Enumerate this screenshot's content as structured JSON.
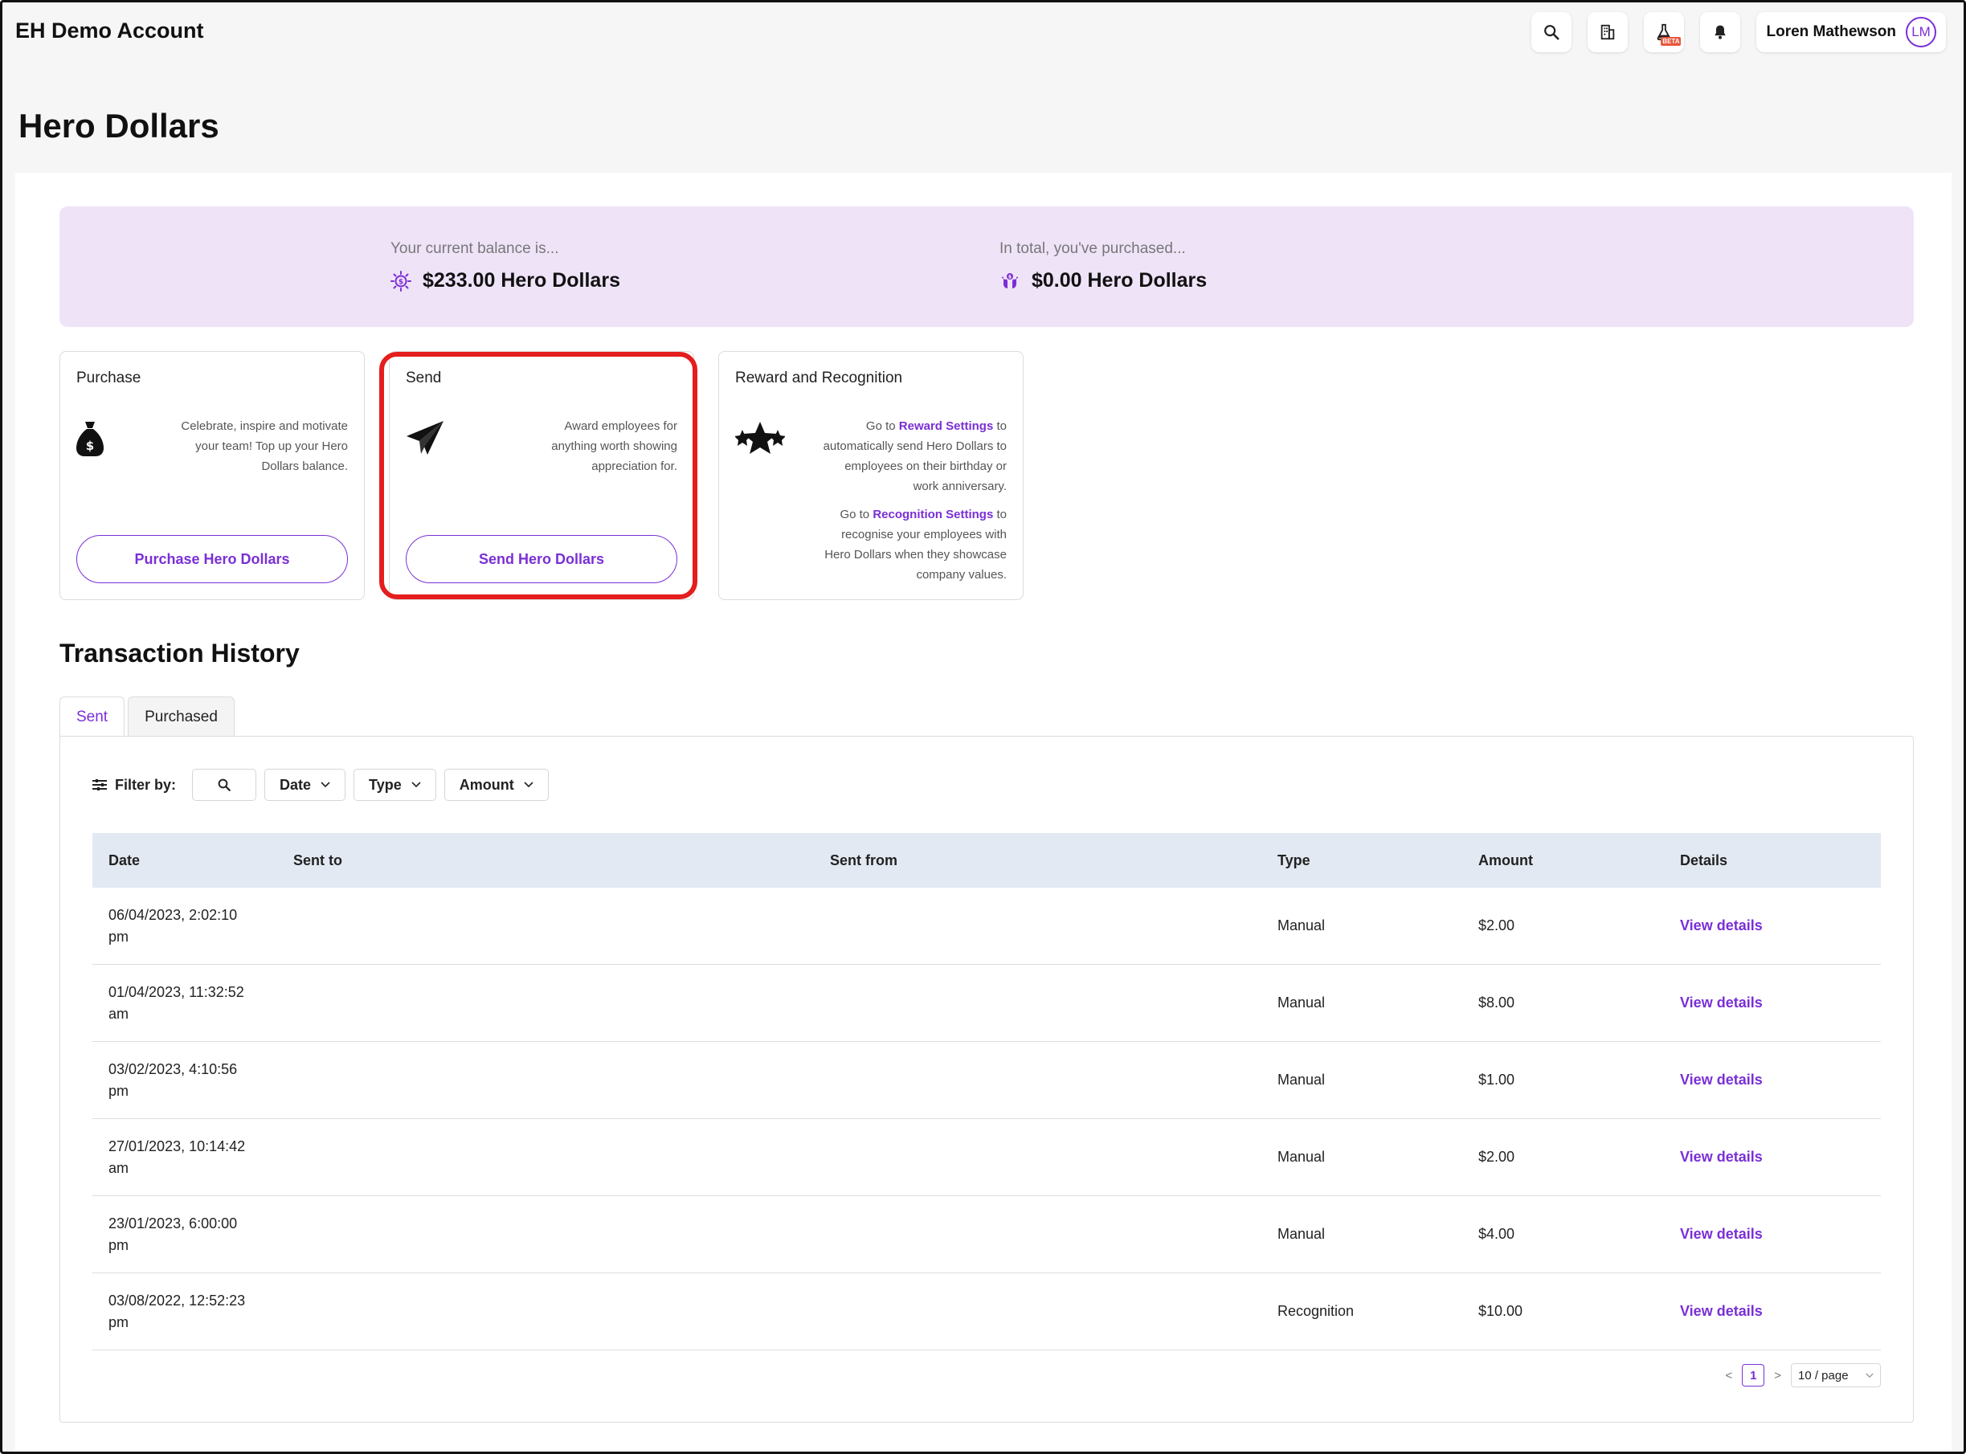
{
  "header": {
    "account_name": "EH Demo Account",
    "user_name": "Loren Mathewson",
    "user_initials": "LM",
    "beta_label": "BETA"
  },
  "page_title": "Hero Dollars",
  "balance": {
    "current_label": "Your current balance is...",
    "current_value": "$233.00 Hero Dollars",
    "purchased_label": "In total, you've purchased...",
    "purchased_value": "$0.00 Hero Dollars"
  },
  "cards": {
    "purchase": {
      "title": "Purchase",
      "description": "Celebrate, inspire and motivate your team! Top up your Hero Dollars balance.",
      "button": "Purchase Hero Dollars"
    },
    "send": {
      "title": "Send",
      "description": "Award employees for anything worth showing appreciation for.",
      "button": "Send Hero Dollars"
    },
    "reward": {
      "title": "Reward and Recognition",
      "p1_prefix": "Go to",
      "p1_link": "Reward Settings",
      "p1_suffix": "to automatically send Hero Dollars to employees on their birthday or work anniversary.",
      "p2_prefix": "Go to",
      "p2_link": "Recognition Settings",
      "p2_suffix": "to recognise your employees with Hero Dollars when they showcase company values."
    }
  },
  "history": {
    "title": "Transaction History",
    "tabs": [
      {
        "label": "Sent",
        "active": true
      },
      {
        "label": "Purchased",
        "active": false
      }
    ],
    "filter_label": "Filter by:",
    "filters": [
      "Date",
      "Type",
      "Amount"
    ],
    "columns": [
      "Date",
      "Sent to",
      "Sent from",
      "Type",
      "Amount",
      "Details"
    ],
    "rows": [
      {
        "date": "06/04/2023, 2:02:10",
        "date2": "pm",
        "sent_to": "",
        "sent_from": "",
        "type": "Manual",
        "amount": "$2.00",
        "details": "View details"
      },
      {
        "date": "01/04/2023, 11:32:52",
        "date2": "am",
        "sent_to": "",
        "sent_from": "",
        "type": "Manual",
        "amount": "$8.00",
        "details": "View details"
      },
      {
        "date": "03/02/2023, 4:10:56",
        "date2": "pm",
        "sent_to": "",
        "sent_from": "",
        "type": "Manual",
        "amount": "$1.00",
        "details": "View details"
      },
      {
        "date": "27/01/2023, 10:14:42",
        "date2": "am",
        "sent_to": "",
        "sent_from": "",
        "type": "Manual",
        "amount": "$2.00",
        "details": "View details"
      },
      {
        "date": "23/01/2023, 6:00:00",
        "date2": "pm",
        "sent_to": "",
        "sent_from": "",
        "type": "Manual",
        "amount": "$4.00",
        "details": "View details"
      },
      {
        "date": "03/08/2022, 12:52:23",
        "date2": "pm",
        "sent_to": "",
        "sent_from": "",
        "type": "Recognition",
        "amount": "$10.00",
        "details": "View details"
      }
    ],
    "pagination": {
      "prev": "<",
      "current_page": "1",
      "next": ">",
      "page_size": "10 / page"
    }
  },
  "colors": {
    "accent": "#7a2fd6",
    "banner_bg": "#efe3f8",
    "highlight": "#e51d1d",
    "table_header_bg": "#e3e9f2"
  }
}
